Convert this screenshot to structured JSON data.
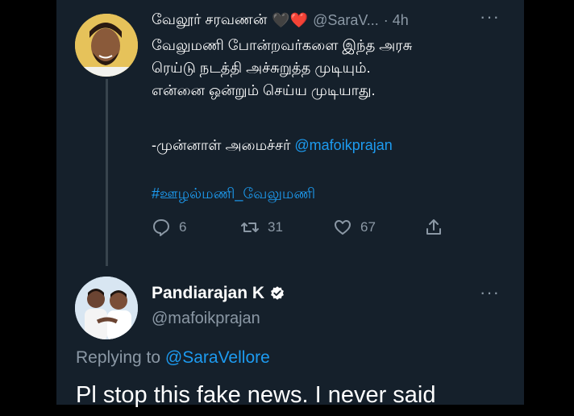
{
  "colors": {
    "background": "#15202b",
    "link": "#1d9bf0",
    "muted": "#8b98a5",
    "heart": "#e0245e"
  },
  "tweet1": {
    "author_name": "வேலூர் சரவணன்",
    "hearts": "🖤❤️",
    "handle": "@SaraV...",
    "time": "· 4h",
    "more_icon": "···",
    "body_lines": [
      "வேலுமணி போன்றவர்களை இந்த அரசு",
      "ரெய்டு நடத்தி அச்சுறுத்த முடியும்.",
      "என்னை ஒன்றும் செய்ய முடியாது."
    ],
    "signature_prefix": "-முன்னாள் அமைச்சர் ",
    "signature_mention": "@mafoikprajan",
    "hashtag": "#ஊழல்மணி_வேலுமணி",
    "actions": {
      "reply_count": "6",
      "retweet_count": "31",
      "like_count": "67"
    }
  },
  "tweet2": {
    "author_name": "Pandiarajan K",
    "handle": "@mafoikprajan",
    "more_icon": "···",
    "replying_prefix": "Replying to ",
    "replying_mention": "@SaraVellore",
    "body": "Pl stop this fake news. I never said"
  }
}
